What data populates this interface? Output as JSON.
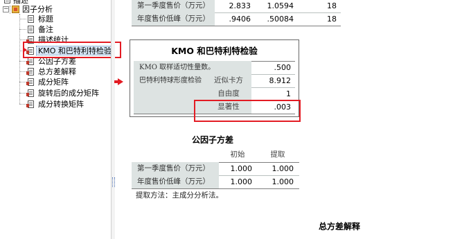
{
  "tree": {
    "top_item": "描述",
    "root": "因子分析",
    "items": [
      {
        "label": "标题"
      },
      {
        "label": "备注"
      },
      {
        "label": "描述统计"
      },
      {
        "label": "KMO 和巴特利特检验",
        "selected": true
      },
      {
        "label": "公因子方差"
      },
      {
        "label": "总方差解释"
      },
      {
        "label": "成分矩阵"
      },
      {
        "label": "旋转后的成分矩阵"
      },
      {
        "label": "成分转换矩阵"
      }
    ]
  },
  "descriptive_tail": {
    "rows": [
      {
        "label": "第一季度售价（万元）",
        "mean": "2.833",
        "sd": "1.0594",
        "n": "18"
      },
      {
        "label": "年度售价低峰（万元）",
        "mean": ".9406",
        "sd": ".50084",
        "n": "18"
      }
    ]
  },
  "kmo": {
    "title": "KMO 和巴特利特检验",
    "kmo_label": "KMO 取样适切性量数。",
    "kmo_value": ".500",
    "bartlett_label": "巴特利特球形度检验",
    "chi_label": "近似卡方",
    "chi_value": "8.912",
    "df_label": "自由度",
    "df_value": "1",
    "sig_label": "显著性",
    "sig_value": ".003"
  },
  "communalities": {
    "title": "公因子方差",
    "col_initial": "初始",
    "col_extraction": "提取",
    "rows": [
      {
        "label": "第一季度售价（万元）",
        "initial": "1.000",
        "extraction": "1.000"
      },
      {
        "label": "年度售价低峰（万元）",
        "initial": "1.000",
        "extraction": "1.000"
      }
    ],
    "note": "提取方法：主成分分析法。"
  },
  "variance": {
    "title": "总方差解释"
  },
  "colors": {
    "highlight": "#e31b23",
    "table_shade": "#dde3e2"
  }
}
